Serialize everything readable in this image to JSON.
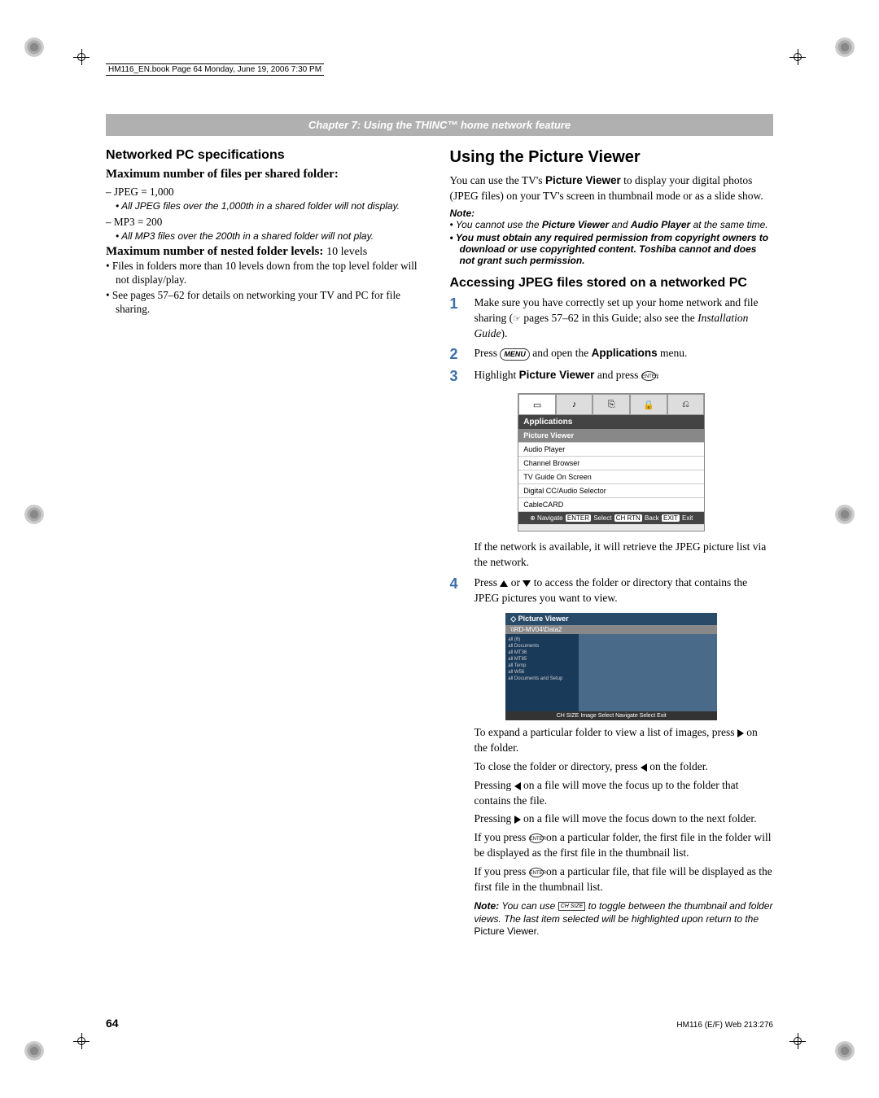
{
  "print": {
    "header": "HM116_EN.book  Page 64  Monday, June 19, 2006  7:30 PM"
  },
  "chapter": "Chapter 7: Using the THINC™ home network feature",
  "left": {
    "h2": "Networked PC specifications",
    "h3a": "Maximum number of files per shared folder:",
    "jpeg": "–  JPEG = 1,000",
    "jpeg_note": "•  All JPEG files over the 1,000th in a shared folder will not display.",
    "mp3": "–  MP3 = 200",
    "mp3_note": "•  All MP3 files over the 200th in a shared folder will not play.",
    "h3b_pre": "Maximum number of nested folder levels: ",
    "h3b_val": "10 levels",
    "b1": "•  Files in folders more than 10 levels down from the top level folder will not display/play.",
    "b2": "•  See pages 57–62 for details on networking your TV and PC for file sharing."
  },
  "right": {
    "h1": "Using the Picture Viewer",
    "intro_a": "You can use the TV's ",
    "intro_b": "Picture Viewer",
    "intro_c": " to display your digital photos (JPEG files) on your TV's screen in thumbnail mode or as a slide show.",
    "note_head": "Note:",
    "note1_a": "•   You cannot use the ",
    "note1_b": "Picture Viewer",
    "note1_c": " and ",
    "note1_d": "Audio Player",
    "note1_e": " at the same time.",
    "note2": "•   You must obtain any required permission from copyright owners to download or use copyrighted content. Toshiba cannot and does not grant such permission.",
    "h2": "Accessing JPEG files stored on a networked PC",
    "s1_a": "Make sure you have correctly set up your home network and file sharing (",
    "s1_b": " pages 57–62 in this Guide; also see the ",
    "s1_c": "Installation Guide",
    "s1_d": ").",
    "s2_a": "Press ",
    "s2_b": " and open the ",
    "s2_c": "Applications",
    "s2_d": " menu.",
    "s3_a": "Highlight ",
    "s3_b": "Picture Viewer",
    "s3_c": " and press ",
    "s3_d": ".",
    "menu": {
      "title": "Applications",
      "items": [
        "Picture Viewer",
        "Audio Player",
        "Channel Browser",
        "TV Guide On Screen",
        "Digital CC/Audio Selector",
        "CableCARD"
      ],
      "foot_nav": "Navigate",
      "foot_sel": "Select",
      "foot_back": "Back",
      "foot_exit": "Exit"
    },
    "s3_after": "If the network is available, it will retrieve the JPEG picture list via the network.",
    "s4_a": "Press ",
    "s4_b": " or ",
    "s4_c": " to access the folder or directory that contains the JPEG pictures you want to view.",
    "pv": {
      "title": "Picture Viewer",
      "path": "\\\\RD-MV04\\Data2",
      "list": [
        "all (6)",
        "all Documents",
        "all MT36",
        "all MT85",
        "all Temp",
        "all W56",
        "all Documents and Setup"
      ],
      "foot": "Image Select    Navigate    Select    Exit"
    },
    "exp_a": "To expand a particular folder to view a list of images, press ",
    "exp_b": " on the folder.",
    "close_a": "To close the folder or directory, press ",
    "close_b": " on the folder.",
    "pleft_a": "Pressing ",
    "pleft_b": " on a file will move the focus up to the folder that contains the file.",
    "pright_a": "Pressing ",
    "pright_b": " on a file will move the focus down to the next folder.",
    "penter1_a": "If you press ",
    "penter1_b": " on a particular folder, the first file in the folder will be displayed as the first file in the thumbnail list.",
    "penter2_a": "If you press ",
    "penter2_b": " on a particular file, that file will be displayed as the first file in the thumbnail list.",
    "fnote_a": "Note:",
    "fnote_b": " You can use ",
    "fnote_c": " to toggle between the thumbnail and folder views. The last item selected will be highlighted upon return to the ",
    "fnote_d": "Picture Viewer",
    "fnote_e": "."
  },
  "page_num": "64",
  "footer_right": "HM116 (E/F) Web 213:276"
}
